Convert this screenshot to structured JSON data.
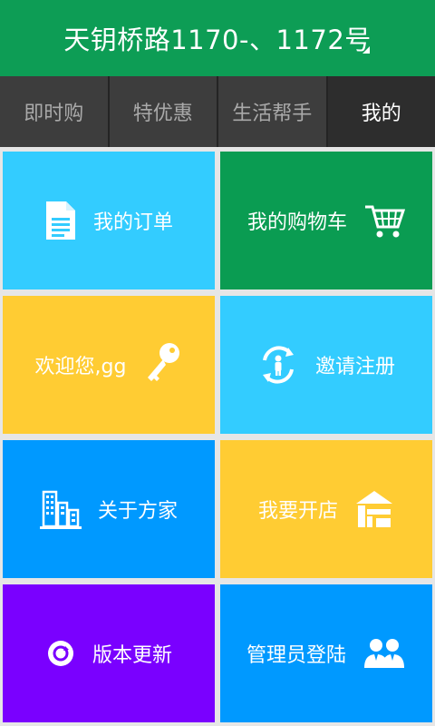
{
  "header": {
    "title": "天钥桥路1170-、1172号"
  },
  "tabs": [
    {
      "label": "即时购"
    },
    {
      "label": "特优惠"
    },
    {
      "label": "生活帮手"
    },
    {
      "label": "我的"
    }
  ],
  "tiles": [
    {
      "label": "我的订单",
      "icon": "document-icon",
      "color": "#33ccff"
    },
    {
      "label": "我的购物车",
      "icon": "shopping-cart-icon",
      "color": "#0a9c52"
    },
    {
      "label": "欢迎您,gg",
      "icon": "key-icon",
      "color": "#ffcc33"
    },
    {
      "label": "邀请注册",
      "icon": "invite-person-icon",
      "color": "#33ccff"
    },
    {
      "label": "关于方家",
      "icon": "buildings-icon",
      "color": "#0099ff"
    },
    {
      "label": "我要开店",
      "icon": "shop-icon",
      "color": "#ffcc33"
    },
    {
      "label": "版本更新",
      "icon": "update-icon",
      "color": "#7a00ff"
    },
    {
      "label": "管理员登陆",
      "icon": "admin-users-icon",
      "color": "#0099ff"
    }
  ]
}
